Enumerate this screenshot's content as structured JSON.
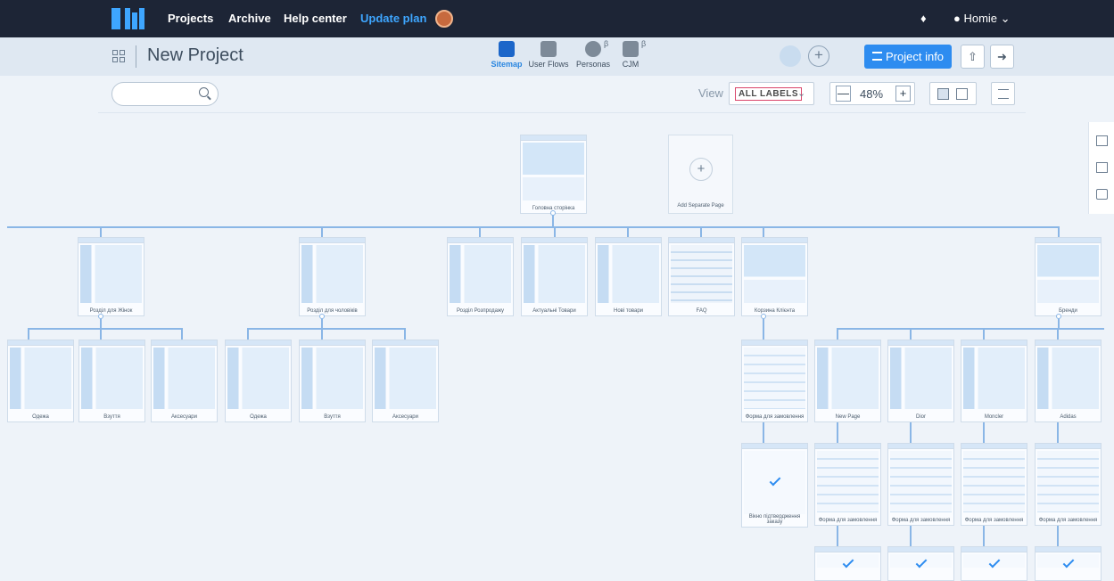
{
  "nav": {
    "projects": "Projects",
    "archive": "Archive",
    "help": "Help center",
    "update": "Update plan",
    "user": "Homie"
  },
  "project": {
    "title": "New Project"
  },
  "views": {
    "sitemap": "Sitemap",
    "userflows": "User Flows",
    "personas": "Personas",
    "cjm": "CJM",
    "beta": "β"
  },
  "toolbar": {
    "project_info": "Project info",
    "view": "View",
    "labels": "ALL LABELS",
    "zoom": "48%"
  },
  "sitemap": {
    "home": "Головна сторінка",
    "add_page": "Add Separate Page",
    "level1": [
      "Розділ для Жінок",
      "Розділ для чоловіків",
      "Розділ Розпродажу",
      "Актуальні Товари",
      "Нові товари",
      "FAQ",
      "Корзина Клієнта",
      "Бренди"
    ],
    "women": [
      "Одежа",
      "Взуття",
      "Аксесуари"
    ],
    "men": [
      "Одежа",
      "Взуття",
      "Аксесуари"
    ],
    "order_form": "Форма для замовлення",
    "confirm": "Вікно підтвердження заказу",
    "brands": [
      "New Page",
      "Dior",
      "Moncler",
      "Adidas"
    ]
  },
  "colors": {
    "accent": "#2d8cf0",
    "nav_bg": "#1d2536",
    "link": "#8ab6e6"
  }
}
